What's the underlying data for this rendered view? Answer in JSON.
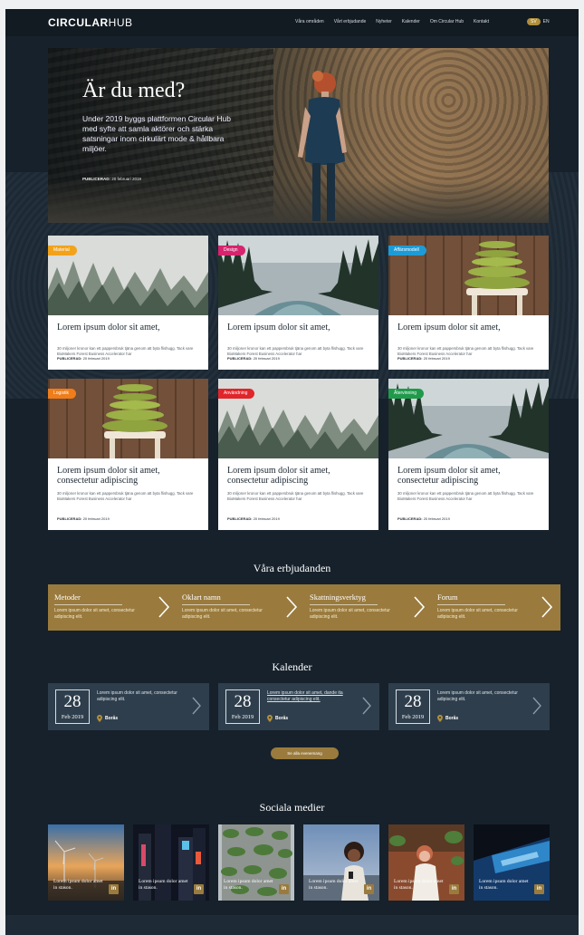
{
  "header": {
    "logo_bold": "CIRCULAR",
    "logo_thin": "HUB",
    "nav": [
      "Våra områden",
      "Vårt erbjudande",
      "Nyheter",
      "Kalender",
      "Om Circular Hub",
      "Kontakt"
    ],
    "lang_active": "SV",
    "lang_other": "EN"
  },
  "hero": {
    "title": "Är du med?",
    "lead": "Under 2019 byggs plattformen Circular Hub med syfte att samla aktörer och stärka satsningar inom cirkulärt mode & hållbara miljöer.",
    "pub_label": "PUBLICERAD:",
    "pub_date": "20 februari 2019"
  },
  "cards": [
    {
      "tag": "Material",
      "tag_color": "#f2a31b",
      "title": "Lorem ipsum dolor sit amet,",
      "excerpt": "30 miljoner kronor kan ett pappersbruk tjäna genom att byta flishugg. Tack vare BioMakers Forest Business Accelerator har",
      "pub_label": "PUBLICERAD:",
      "date": "20 februari 2019",
      "image": "fog-forest"
    },
    {
      "tag": "Design",
      "tag_color": "#d6246e",
      "title": "Lorem ipsum dolor sit amet,",
      "excerpt": "30 miljoner kronor kan ett pappersbruk tjäna genom att byta flishugg. Tack vare BioMakers Forest Business Accelerator har",
      "pub_label": "PUBLICERAD:",
      "date": "20 februari 2019",
      "image": "river"
    },
    {
      "tag": "Affärsmodell",
      "tag_color": "#1d9bd7",
      "title": "Lorem ipsum dolor sit amet,",
      "excerpt": "30 miljoner kronor kan ett pappersbruk tjäna genom att byta flishugg. Tack vare BioMakers Forest Business Accelerator har",
      "pub_label": "PUBLICERAD:",
      "date": "20 februari 2019",
      "image": "towels"
    },
    {
      "tag": "Logistik",
      "tag_color": "#ef7d1a",
      "title": "Lorem ipsum dolor sit amet, consectetur adipiscing",
      "excerpt": "30 miljoner kronor kan ett pappersbruk tjäna genom att byta flishugg. Tack vare BioMakers Forest Business Accelerator har",
      "pub_label": "PUBLICERAD:",
      "date": "20 februari 2019",
      "image": "towels"
    },
    {
      "tag": "Användning",
      "tag_color": "#e0262b",
      "title": "Lorem ipsum dolor sit amet, consectetur adipiscing",
      "excerpt": "30 miljoner kronor kan ett pappersbruk tjäna genom att byta flishugg. Tack vare BioMakers Forest Business Accelerator har",
      "pub_label": "PUBLICERAD:",
      "date": "20 februari 2019",
      "image": "fog-forest"
    },
    {
      "tag": "Återvinning",
      "tag_color": "#1f9a4b",
      "title": "Lorem ipsum dolor sit amet, consectetur adipiscing",
      "excerpt": "30 miljoner kronor kan ett pappersbruk tjäna genom att byta flishugg. Tack vare BioMakers Forest Business Accelerator har",
      "pub_label": "PUBLICERAD:",
      "date": "20 februari 2019",
      "image": "river"
    }
  ],
  "offerings": {
    "title": "Våra erbjudanden",
    "items": [
      {
        "title": "Metoder",
        "text": "Lorem ipsum dolor sit amet, consectetur adipiscing elit."
      },
      {
        "title": "Oklart namn",
        "text": "Lorem ipsum dolor sit amet, consectetur adipiscing elit."
      },
      {
        "title": "Skattningsverktyg",
        "text": "Lorem ipsum dolor sit amet, consectetur adipiscing elit."
      },
      {
        "title": "Forum",
        "text": "Lorem ipsum dolor sit amet, consectetur adipiscing elit."
      }
    ]
  },
  "calendar": {
    "title": "Kalender",
    "events": [
      {
        "day": "28",
        "month": "Feb 2019",
        "text": "Lorem ipsum dolor sit amet, consectetur adipiscing elit.",
        "location": "Borås",
        "link": false
      },
      {
        "day": "28",
        "month": "Feb 2019",
        "text": "Lorem ipsum dolor sit amet, dande ita consectetur adipiscing elit.",
        "location": "Borås",
        "link": true
      },
      {
        "day": "28",
        "month": "Feb 2019",
        "text": "Lorem ipsum dolor sit amet, consectetur adipiscing elit.",
        "location": "Borås",
        "link": false
      }
    ],
    "all_button": "Se alla evenemang"
  },
  "social": {
    "title": "Sociala medier",
    "posts": [
      {
        "text": "Lorem ipsum dolor amet in stason.",
        "icon": "in",
        "image": "wind-turbines"
      },
      {
        "text": "Lorem ipsum dolor amet in stason.",
        "icon": "in",
        "image": "city-night"
      },
      {
        "text": "Lorem ipsum dolor amet in stason.",
        "icon": "in",
        "image": "green-building"
      },
      {
        "text": "Lorem ipsum dolor amet in stason.",
        "icon": "in",
        "image": "woman-phone"
      },
      {
        "text": "Lorem ipsum dolor amet in stason.",
        "icon": "in",
        "image": "woman-plants"
      },
      {
        "text": "Lorem ipsum dolor amet in stason.",
        "icon": "in",
        "image": "laptop-screen"
      }
    ]
  }
}
